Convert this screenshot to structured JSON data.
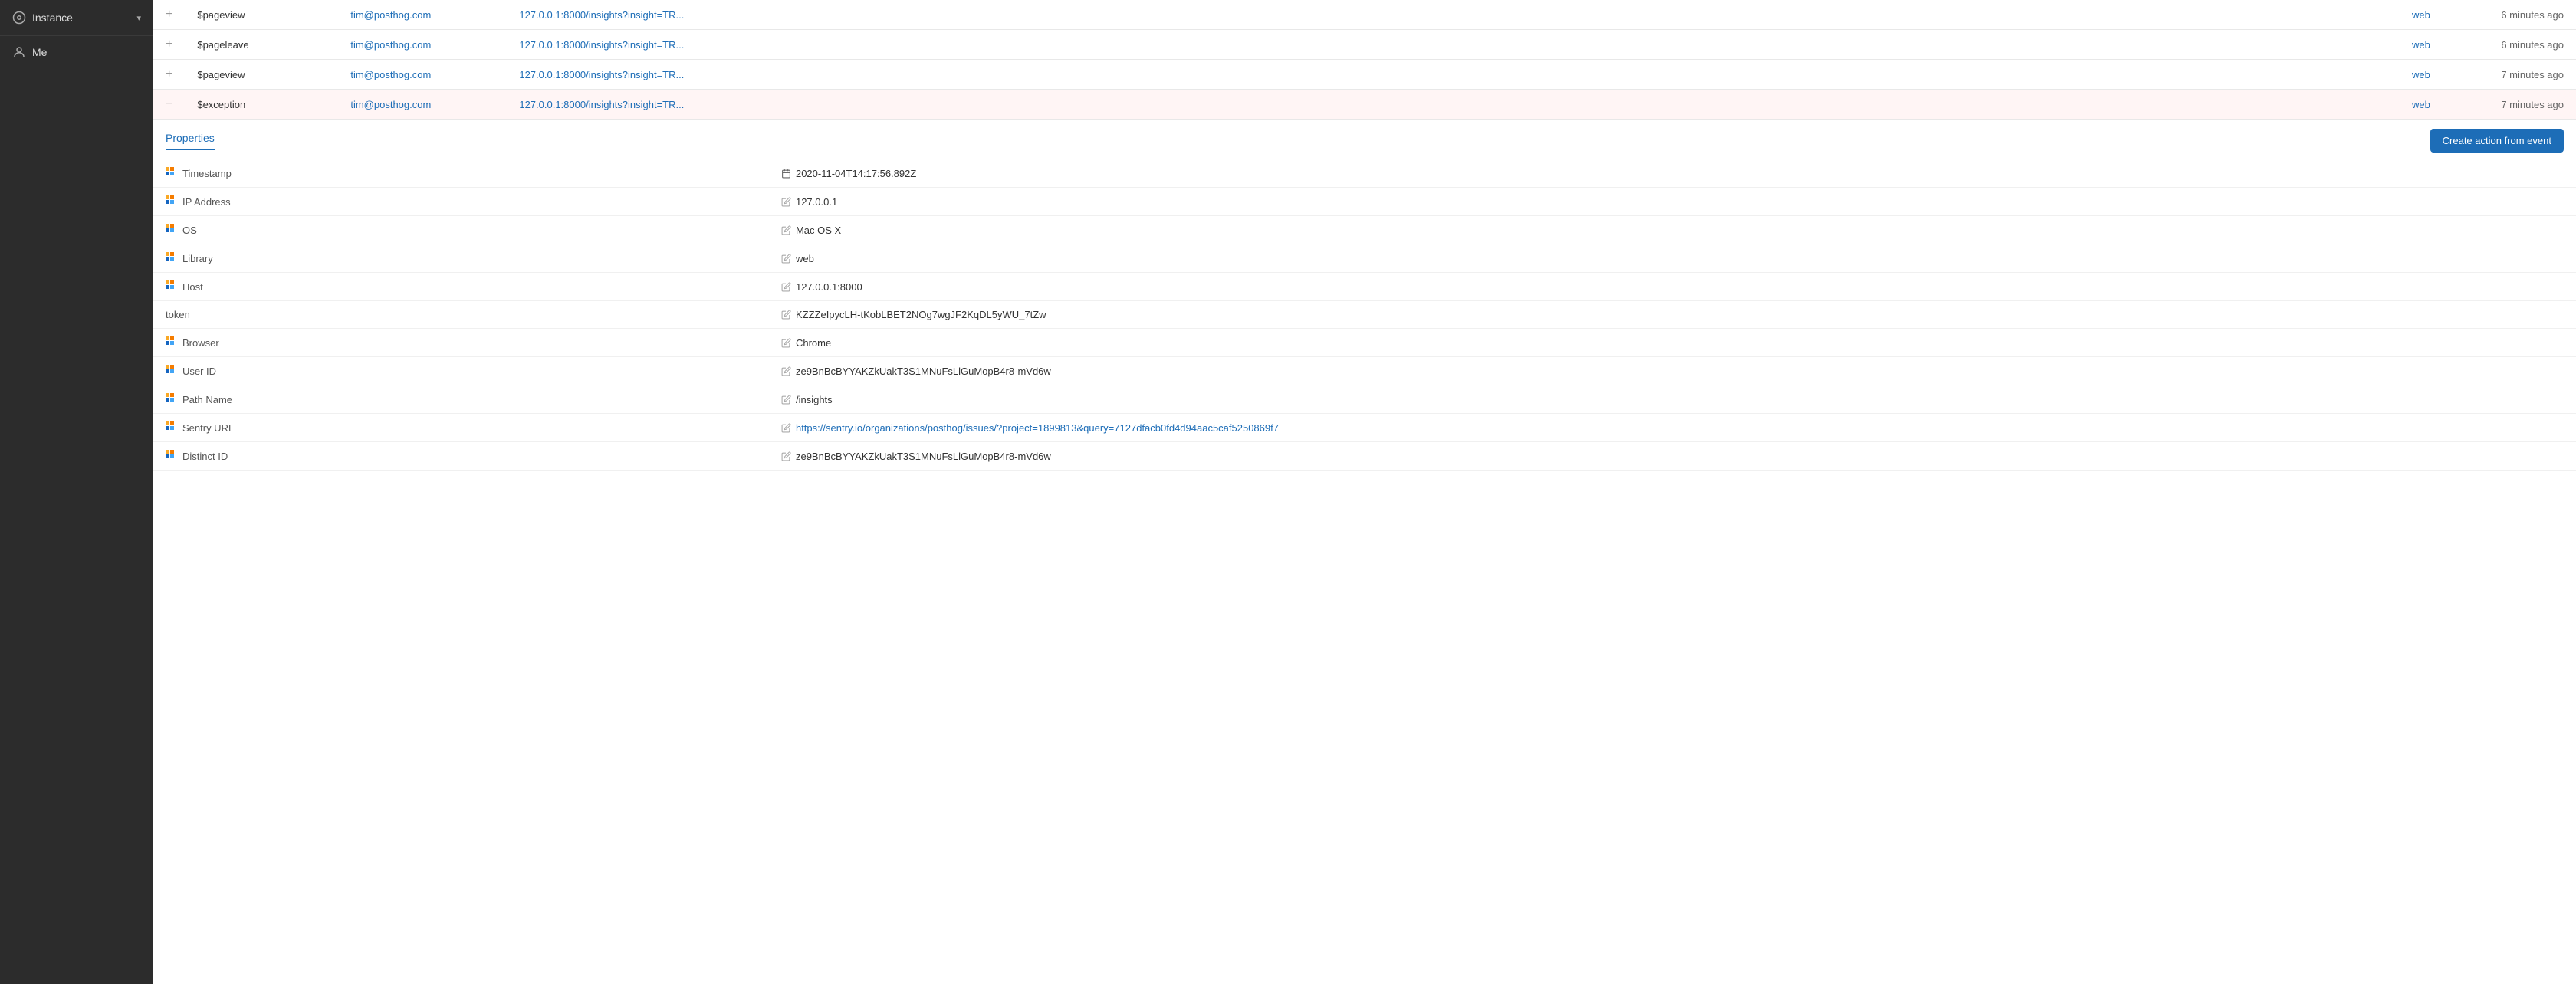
{
  "sidebar": {
    "instance_label": "Instance",
    "chevron": "▾",
    "user_label": "Me"
  },
  "events": [
    {
      "expand": "+",
      "event": "$pageview",
      "person": "tim@posthog.com",
      "url": "127.0.0.1:8000/insights?insight=TR...",
      "lib": "web",
      "time": "6 minutes ago",
      "selected": false
    },
    {
      "expand": "+",
      "event": "$pageleave",
      "person": "tim@posthog.com",
      "url": "127.0.0.1:8000/insights?insight=TR...",
      "lib": "web",
      "time": "6 minutes ago",
      "selected": false
    },
    {
      "expand": "+",
      "event": "$pageview",
      "person": "tim@posthog.com",
      "url": "127.0.0.1:8000/insights?insight=TR...",
      "lib": "web",
      "time": "7 minutes ago",
      "selected": false
    },
    {
      "expand": "−",
      "event": "$exception",
      "person": "tim@posthog.com",
      "url": "127.0.0.1:8000/insights?insight=TR...",
      "lib": "web",
      "time": "7 minutes ago",
      "selected": true
    }
  ],
  "properties": {
    "tab_label": "Properties",
    "create_action_label": "Create action from event",
    "rows": [
      {
        "key": "Timestamp",
        "value": "2020-11-04T14:17:56.892Z",
        "has_icon": true
      },
      {
        "key": "IP Address",
        "value": "127.0.0.1",
        "has_icon": true
      },
      {
        "key": "OS",
        "value": "Mac OS X",
        "has_icon": true
      },
      {
        "key": "Library",
        "value": "web",
        "has_icon": true
      },
      {
        "key": "Host",
        "value": "127.0.0.1:8000",
        "has_icon": true
      },
      {
        "key": "token",
        "value": "KZZZeIpycLH-tKobLBET2NOg7wgJF2KqDL5yWU_7tZw",
        "has_icon": false
      },
      {
        "key": "Browser",
        "value": "Chrome",
        "has_icon": true
      },
      {
        "key": "User ID",
        "value": "ze9BnBcBYYAKZkUakT3S1MNuFsLlGuMopB4r8-mVd6w",
        "has_icon": true
      },
      {
        "key": "Path Name",
        "value": "/insights",
        "has_icon": true
      },
      {
        "key": "Sentry URL",
        "value": "https://sentry.io/organizations/posthog/issues/?project=1899813&query=7127dfacb0fd4d94aac5caf5250869f7",
        "has_icon": true,
        "is_link": true
      },
      {
        "key": "Distinct ID",
        "value": "ze9BnBcBYYAKZkUakT3S1MNuFsLlGuMopB4r8-mVd6w",
        "has_icon": true
      }
    ]
  }
}
